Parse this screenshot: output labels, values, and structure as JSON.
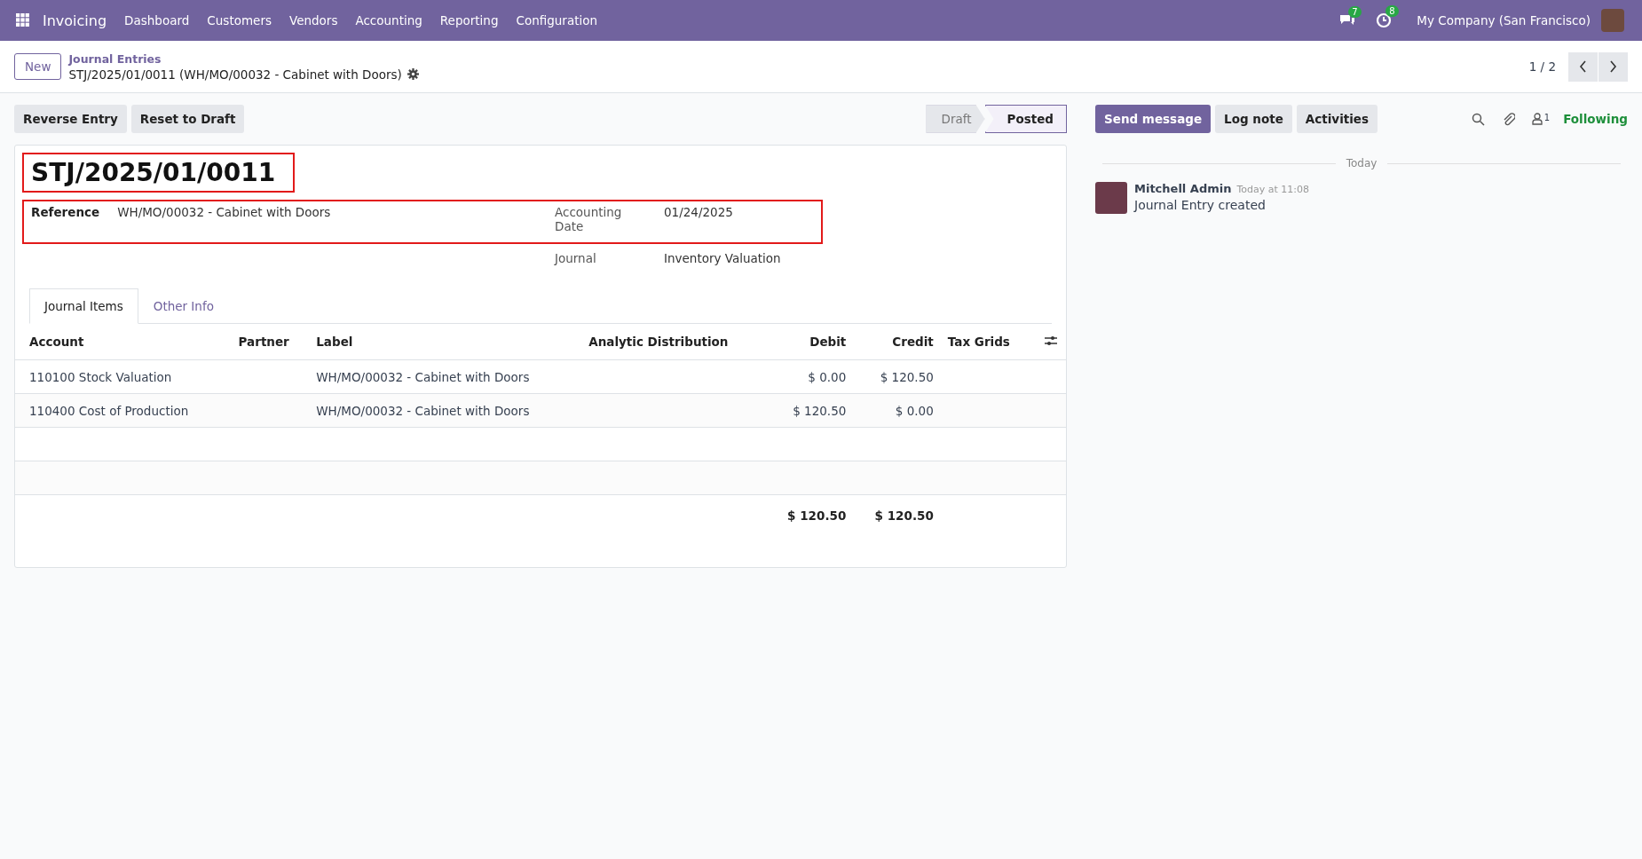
{
  "navbar": {
    "app_name": "Invoicing",
    "menu": [
      "Dashboard",
      "Customers",
      "Vendors",
      "Accounting",
      "Reporting",
      "Configuration"
    ],
    "messages_badge": "7",
    "activities_badge": "8",
    "company": "My Company (San Francisco)"
  },
  "control_panel": {
    "new_button": "New",
    "breadcrumb": "Journal Entries",
    "record_title": "STJ/2025/01/0011 (WH/MO/00032 - Cabinet with Doors)",
    "pager": "1 / 2"
  },
  "actions": [
    "Reverse Entry",
    "Reset to Draft"
  ],
  "status_bar": [
    {
      "label": "Draft",
      "selected": false
    },
    {
      "label": "Posted",
      "selected": true
    }
  ],
  "form": {
    "title": "STJ/2025/01/0011",
    "reference_label": "Reference",
    "reference": "WH/MO/00032 - Cabinet with Doors",
    "date_label": "Accounting Date",
    "date": "01/24/2025",
    "journal_label": "Journal",
    "journal": "Inventory Valuation"
  },
  "tabs": [
    {
      "label": "Journal Items",
      "selected": true
    },
    {
      "label": "Other Info",
      "selected": false
    }
  ],
  "table": {
    "columns": [
      "Account",
      "Partner",
      "Label",
      "Analytic Distribution",
      "Debit",
      "Credit",
      "Tax Grids"
    ],
    "rows": [
      [
        "110100 Stock Valuation",
        "",
        "WH/MO/00032 - Cabinet with Doors",
        "",
        "$ 0.00",
        "$ 120.50",
        ""
      ],
      [
        "110400 Cost of Production",
        "",
        "WH/MO/00032 - Cabinet with Doors",
        "",
        "$ 120.50",
        "$ 0.00",
        ""
      ]
    ],
    "totals": {
      "debit": "$ 120.50",
      "credit": "$ 120.50"
    }
  },
  "chatter": {
    "buttons": [
      "Send message",
      "Log note",
      "Activities"
    ],
    "followers_count": "1",
    "following": "Following",
    "date_separator": "Today",
    "messages": [
      {
        "author": "Mitchell Admin",
        "time": "Today at 11:08",
        "body": "Journal Entry created"
      }
    ]
  }
}
